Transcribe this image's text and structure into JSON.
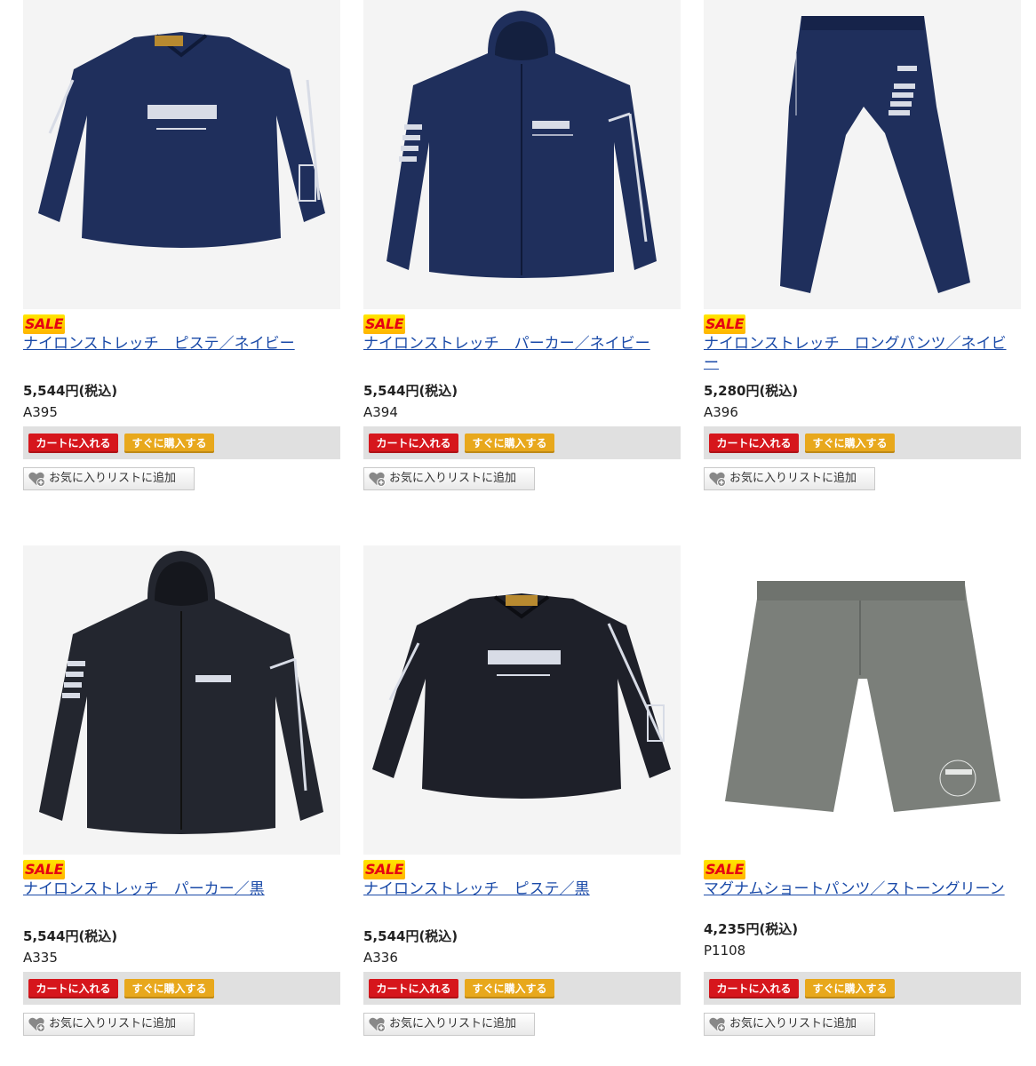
{
  "labels": {
    "sale": "SALE",
    "add_to_cart": "カートに入れる",
    "buy_now": "すぐに購入する",
    "add_to_favorites": "お気に入りリストに追加"
  },
  "products": [
    {
      "name": "ナイロンストレッチ　ピステ／ネイビー",
      "price": "5,544円(税込)",
      "sku": "A395",
      "garment": "pullover",
      "color": "#1f2f5c"
    },
    {
      "name": "ナイロンストレッチ　パーカー／ネイビー",
      "price": "5,544円(税込)",
      "sku": "A394",
      "garment": "hoodie",
      "color": "#1f2f5c"
    },
    {
      "name": "ナイロンストレッチ　ロングパンツ／ネイビー",
      "price": "5,280円(税込)",
      "sku": "A396",
      "garment": "pants",
      "color": "#1f2f5c"
    },
    {
      "name": "ナイロンストレッチ　パーカー／黒",
      "price": "5,544円(税込)",
      "sku": "A335",
      "garment": "hoodie",
      "color": "#23262f"
    },
    {
      "name": "ナイロンストレッチ　ピステ／黒",
      "price": "5,544円(税込)",
      "sku": "A336",
      "garment": "pullover",
      "color": "#1e2029"
    },
    {
      "name": "マグナムショートパンツ／ストーングリーン",
      "price": "4,235円(税込)",
      "sku": "P1108",
      "garment": "shorts",
      "color": "#7b7f7a"
    }
  ]
}
